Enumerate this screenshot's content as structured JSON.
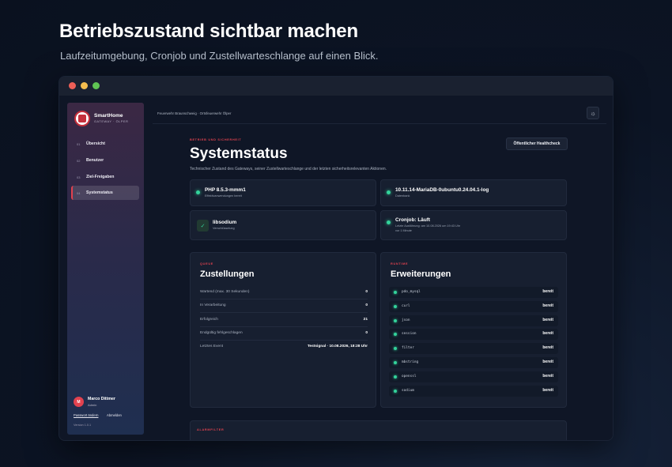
{
  "hero": {
    "title": "Betriebszustand sichtbar machen",
    "subtitle": "Laufzeitumgebung, Cronjob und Zustellwarteschlange auf einen Blick."
  },
  "sidebar": {
    "brand_name": "SmartHome",
    "brand_sub": "GATEWAY · ÖLPER",
    "items": [
      {
        "num": "01",
        "label": "Übersicht"
      },
      {
        "num": "02",
        "label": "Benutzer"
      },
      {
        "num": "03",
        "label": "Ziel-Freigaben"
      },
      {
        "num": "04",
        "label": "Systemstatus"
      }
    ],
    "active_index": 3,
    "user": {
      "initials": "M",
      "name": "Marco Dittmer",
      "role": "Admin"
    },
    "password_link": "Passwort ändern",
    "logout_link": "Abmelden",
    "version": "Version 1.0.1"
  },
  "topbar": {
    "breadcrumb": "Feuerwehr Braunschweig · Ortsfeuerwehr Ölper",
    "theme_icon": "sun-icon"
  },
  "page": {
    "eyebrow": "BETRIEB UND SICHERHEIT",
    "title": "Systemstatus",
    "description": "Technischer Zustand des Gateways, seiner Zustellwarteschlange und der letzten sicherheitsrelevanten Aktionen.",
    "health_button": "Öffentlicher Healthcheck"
  },
  "status_cards": [
    {
      "title": "PHP 8.5.3-mmm1",
      "sub": "Effektivanwendungen bereit"
    },
    {
      "title": "10.11.14-MariaDB-0ubuntu0.24.04.1-log",
      "sub": "Datenbank"
    },
    {
      "title": "libsodium",
      "sub": "Verschlüsselung"
    },
    {
      "title": "Cronjob: Läuft",
      "sub1": "Letzte Ausführung: am 10.08.2026 um 19:43 Uhr",
      "sub2": "vor 1 Minute"
    }
  ],
  "queue": {
    "eyebrow": "QUEUE",
    "title": "Zustellungen",
    "rows": [
      {
        "label": "Wartend (max. 30 Sekunden)",
        "value": "0"
      },
      {
        "label": "In Verarbeitung",
        "value": "0"
      },
      {
        "label": "Erfolgreich",
        "value": "21"
      },
      {
        "label": "Endgültig fehlgeschlagen",
        "value": "0"
      },
      {
        "label": "Letztes Event",
        "value": "Testsignal · 10.08.2026, 18:28 Uhr"
      }
    ]
  },
  "runtime": {
    "eyebrow": "RUNTIME",
    "title": "Erweiterungen",
    "extensions": [
      {
        "name": "pdo_mysql",
        "state": "bereit"
      },
      {
        "name": "curl",
        "state": "bereit"
      },
      {
        "name": "json",
        "state": "bereit"
      },
      {
        "name": "session",
        "state": "bereit"
      },
      {
        "name": "filter",
        "state": "bereit"
      },
      {
        "name": "mbstring",
        "state": "bereit"
      },
      {
        "name": "openssl",
        "state": "bereit"
      },
      {
        "name": "sodium",
        "state": "bereit"
      }
    ]
  },
  "alarm": {
    "eyebrow": "ALARMFILTER"
  },
  "colors": {
    "accent": "#e2424f",
    "ok": "#33d39b"
  }
}
